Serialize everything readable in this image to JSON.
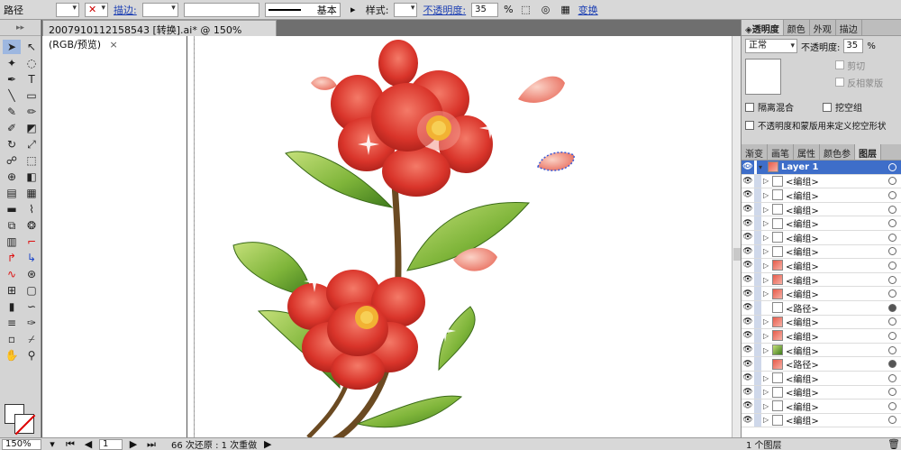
{
  "control_bar": {
    "object_type": "路径",
    "stroke_label": "描边:",
    "stroke_profile": "基本",
    "style_label": "样式:",
    "opacity_label": "不透明度:",
    "opacity_value": "35",
    "opacity_unit": "%",
    "transform_label": "变换"
  },
  "document": {
    "tab_title": "2007910112158543 [转换].ai* @ 150% (RGB/预览)",
    "tab_close": "×"
  },
  "status_bar": {
    "zoom": "150%",
    "page": "1",
    "undo_text": "66 次还原 : 1 次重做"
  },
  "transparency_panel": {
    "tabs": [
      "◈透明度",
      "颜色",
      "外观",
      "描边"
    ],
    "blend_mode": "正常",
    "opacity_label": "不透明度:",
    "opacity_value": "35",
    "opacity_unit": "%",
    "clip_label": "剪切",
    "invert_mask_label": "反相蒙版",
    "isolate_label": "隔离混合",
    "knockout_label": "挖空组",
    "opacity_mask_label": "不透明度和蒙版用来定义挖空形状"
  },
  "layers_panel": {
    "tabs": [
      "渐变",
      "画笔",
      "属性",
      "颜色参",
      "图层"
    ],
    "layer_name": "Layer 1",
    "items": [
      {
        "name": "<编组>",
        "thumb": "plain",
        "target": "empty"
      },
      {
        "name": "<编组>",
        "thumb": "plain",
        "target": "empty"
      },
      {
        "name": "<编组>",
        "thumb": "plain",
        "target": "empty"
      },
      {
        "name": "<编组>",
        "thumb": "plain",
        "target": "empty"
      },
      {
        "name": "<编组>",
        "thumb": "plain",
        "target": "empty"
      },
      {
        "name": "<编组>",
        "thumb": "plain",
        "target": "empty"
      },
      {
        "name": "<编组>",
        "thumb": "flower",
        "target": "empty"
      },
      {
        "name": "<编组>",
        "thumb": "flower",
        "target": "empty"
      },
      {
        "name": "<编组>",
        "thumb": "flower",
        "target": "empty"
      },
      {
        "name": "<路径>",
        "thumb": "plain",
        "target": "filled"
      },
      {
        "name": "<编组>",
        "thumb": "flower",
        "target": "empty"
      },
      {
        "name": "<编组>",
        "thumb": "flower",
        "target": "empty"
      },
      {
        "name": "<编组>",
        "thumb": "leaf",
        "target": "empty"
      },
      {
        "name": "<路径>",
        "thumb": "flower",
        "target": "filled"
      },
      {
        "name": "<编组>",
        "thumb": "plain",
        "target": "empty"
      },
      {
        "name": "<编组>",
        "thumb": "plain",
        "target": "empty"
      },
      {
        "name": "<编组>",
        "thumb": "plain",
        "target": "empty"
      },
      {
        "name": "<编组>",
        "thumb": "plain",
        "target": "empty"
      }
    ],
    "footer": "1 个图层"
  },
  "colors": {
    "selection_blue": "#3e6ec9",
    "petal_red": "#d9342a",
    "leaf_green": "#7fb53a"
  }
}
